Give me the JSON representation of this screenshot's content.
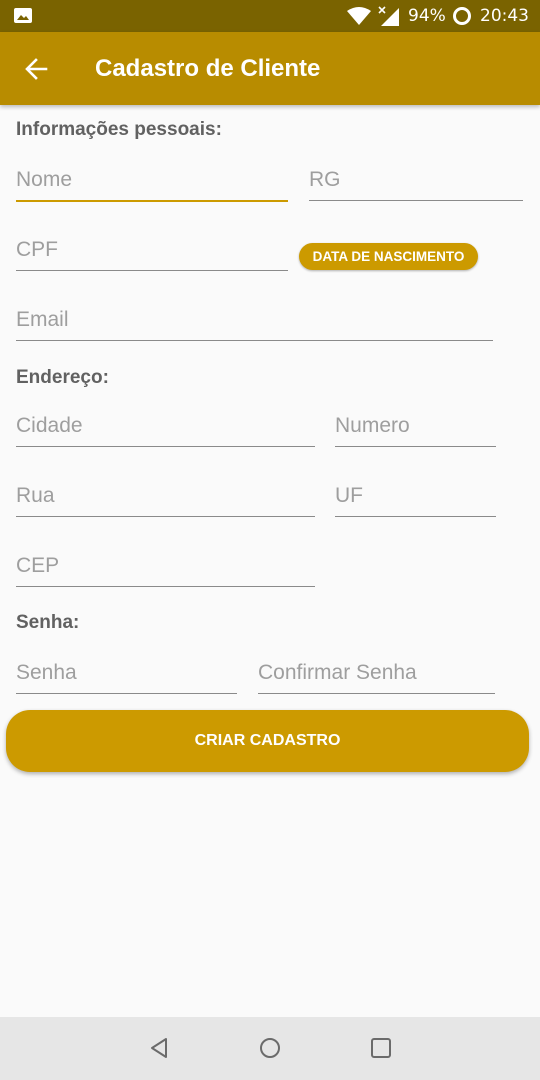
{
  "status_bar": {
    "battery": "94%",
    "time": "20:43",
    "icons": [
      "gallery-icon",
      "wifi-icon",
      "signal-icon",
      "battery-icon"
    ]
  },
  "app_bar": {
    "title": "Cadastro de Cliente",
    "back_icon": "arrow-left-icon"
  },
  "sections": {
    "personal": "Informações pessoais:",
    "address": "Endereço:",
    "password": "Senha:"
  },
  "fields": {
    "nome": {
      "placeholder": "Nome",
      "value": ""
    },
    "rg": {
      "placeholder": "RG",
      "value": ""
    },
    "cpf": {
      "placeholder": "CPF",
      "value": ""
    },
    "email": {
      "placeholder": "Email",
      "value": ""
    },
    "cidade": {
      "placeholder": "Cidade",
      "value": ""
    },
    "numero": {
      "placeholder": "Numero",
      "value": ""
    },
    "rua": {
      "placeholder": "Rua",
      "value": ""
    },
    "uf": {
      "placeholder": "UF",
      "value": ""
    },
    "cep": {
      "placeholder": "CEP",
      "value": ""
    },
    "senha": {
      "placeholder": "Senha",
      "value": ""
    },
    "confirmar_senha": {
      "placeholder": "Confirmar Senha",
      "value": ""
    }
  },
  "buttons": {
    "birth_date": "DATA DE NASCIMENTO",
    "submit": "CRIAR CADASTRO"
  },
  "colors": {
    "status_bar": "#7a6300",
    "app_bar": "#b88c00",
    "accent": "#cc9a00",
    "background": "#fafafa",
    "nav_bar": "#e6e6e6"
  },
  "nav_bar": {
    "icons": [
      "back-triangle-icon",
      "home-circle-icon",
      "recents-square-icon"
    ]
  }
}
